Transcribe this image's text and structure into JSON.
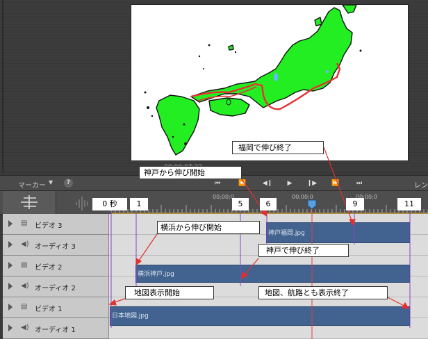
{
  "preview": {
    "timecode": "00;00;07;22"
  },
  "toolbar": {
    "marker_label": "マーカー",
    "marker_arrow": "▼",
    "help_label": "?",
    "render_label": "レンダ"
  },
  "ruler": {
    "timecodes": [
      "00;00;0",
      "00;00;0",
      "00;00;0"
    ]
  },
  "tracks": [
    {
      "name": "ビデオ 3",
      "kind": "video"
    },
    {
      "name": "オーディオ 3",
      "kind": "audio"
    },
    {
      "name": "ビデオ 2",
      "kind": "video"
    },
    {
      "name": "オーディオ 2",
      "kind": "audio"
    },
    {
      "name": "ビデオ 1",
      "kind": "video"
    },
    {
      "name": "オーディオ 1",
      "kind": "audio"
    }
  ],
  "clips": {
    "fukuoka": "神戸福岡.jpg",
    "kobe": "横浜神戸.jpg",
    "map": "日本地図.jpg"
  },
  "markers": {
    "m0": "0 秒",
    "m1": "1",
    "m5": "5",
    "m6": "6",
    "m9": "9",
    "m11": "11"
  },
  "callouts": {
    "fukuoka_end": "福岡で伸び終了",
    "kobe_start": "神戸から伸び開始",
    "yokohama_start": "横浜から伸び開始",
    "kobe_end": "神戸で伸び終了",
    "map_start": "地図表示開始",
    "all_end": "地図、航路とも表示終了"
  },
  "colors": {
    "land": "#22ee22",
    "route": "#e63232",
    "clip": "#42638f",
    "playhead": "#d84040",
    "marker_line": "#8844cc"
  }
}
